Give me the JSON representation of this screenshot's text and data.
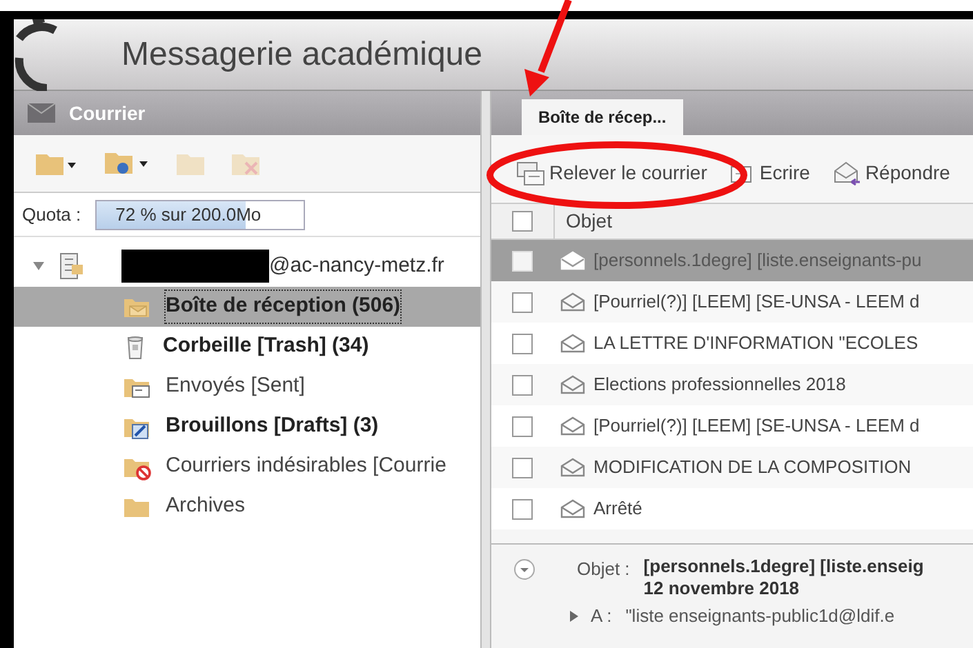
{
  "header": {
    "title": "Messagerie académique"
  },
  "sidebar": {
    "title": "Courrier",
    "quota": {
      "label": "Quota :",
      "reading": "72 % sur 200.0Mo",
      "level": 0.72
    },
    "account": {
      "address": "@ac-nancy-metz.fr",
      "expanded": true
    },
    "folders": [
      {
        "kind": "inbox",
        "label": "Boîte de réception (506)",
        "unread": true,
        "selected": true
      },
      {
        "kind": "trash",
        "label": "Corbeille [Trash] (34)",
        "unread": true,
        "selected": false
      },
      {
        "kind": "sent",
        "label": "Envoyés [Sent]",
        "unread": false,
        "selected": false
      },
      {
        "kind": "drafts",
        "label": "Brouillons [Drafts] (3)",
        "unread": true,
        "selected": false
      },
      {
        "kind": "junk",
        "label": "Courriers indésirables [Courrie",
        "unread": false,
        "selected": false
      },
      {
        "kind": "folder",
        "label": "Archives",
        "unread": false,
        "selected": false
      }
    ]
  },
  "tabs": [
    {
      "label": "Boîte de récep...",
      "selected": true
    }
  ],
  "toolbar": [
    {
      "kind": "fetch",
      "label": "Relever le courrier"
    },
    {
      "kind": "write",
      "label": "Ecrire"
    },
    {
      "kind": "reply",
      "label": "Répondre"
    }
  ],
  "table": {
    "column": "Objet",
    "select_all": {
      "checked": false
    },
    "rows": [
      {
        "subject": "[personnels.1degre] [liste.enseignants-pu",
        "selected": true,
        "checked": false
      },
      {
        "subject": "[Pourriel(?)] [LEEM] [SE-UNSA - LEEM d",
        "selected": false,
        "checked": false
      },
      {
        "subject": "LA LETTRE D'INFORMATION \"ECOLES",
        "selected": false,
        "checked": false
      },
      {
        "subject": "Elections professionnelles 2018",
        "selected": false,
        "checked": false
      },
      {
        "subject": "[Pourriel(?)] [LEEM] [SE-UNSA - LEEM d",
        "selected": false,
        "checked": false
      },
      {
        "subject": "MODIFICATION DE LA COMPOSITION",
        "selected": false,
        "checked": false
      },
      {
        "subject": "Arrêté",
        "selected": false,
        "checked": false
      }
    ]
  },
  "preview": {
    "subject_label": "Objet :",
    "subject": "[personnels.1degre] [liste.enseig",
    "date": "12 novembre 2018",
    "to_label": "A :",
    "to": "\"liste enseignants-public1d@ldif.e"
  }
}
